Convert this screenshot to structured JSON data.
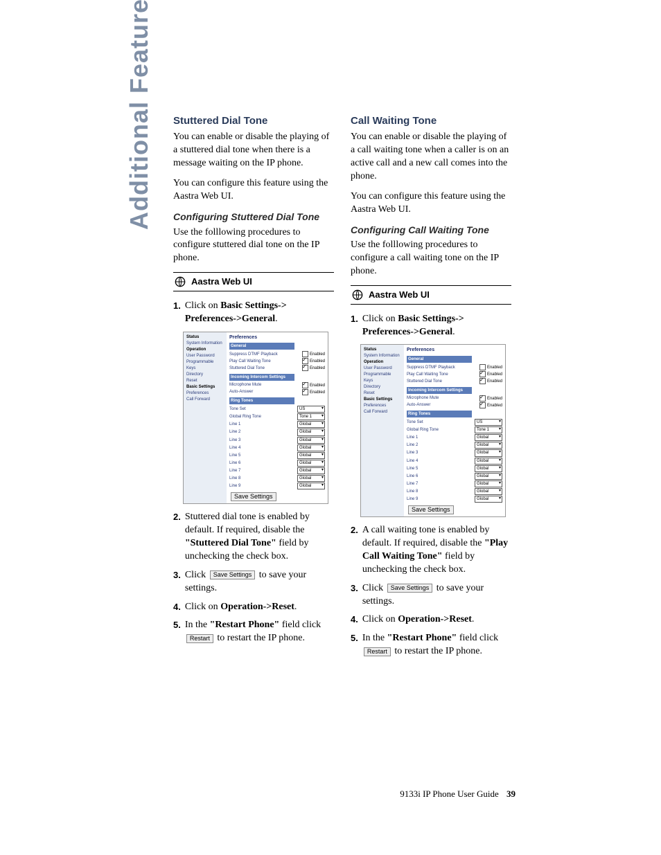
{
  "sideTitle": "Additional Features",
  "footer": {
    "guide": "9133i IP Phone User Guide",
    "page": "39"
  },
  "common": {
    "webUiLabel": "Aastra Web UI",
    "saveSettingsBtn": "Save Settings",
    "restartBtn": "Restart"
  },
  "left": {
    "h1": "Stuttered Dial Tone",
    "p1": "You can enable or disable the playing of a stuttered dial tone when there is a message waiting on the IP phone.",
    "p2": "You can configure this feature using the Aastra Web UI.",
    "h2": "Configuring Stuttered Dial Tone",
    "p3": "Use the folllowing procedures to configure stuttered dial tone on the IP phone.",
    "steps": {
      "s1a": "Click on ",
      "s1b": "Basic Settings-> Preferences->General",
      "s1c": ".",
      "s2a": "Stuttered dial tone is enabled by default. If required, disable the ",
      "s2b": "\"Stuttered Dial Tone\"",
      "s2c": " field by unchecking the check box.",
      "s3a": "Click ",
      "s3b": " to save your settings.",
      "s4a": "Click on ",
      "s4b": "Operation->Reset",
      "s4c": ".",
      "s5a": "In the ",
      "s5b": "\"Restart Phone\"",
      "s5c": " field click ",
      "s5d": " to restart the IP phone."
    }
  },
  "right": {
    "h1": "Call Waiting Tone",
    "p1": "You can enable or disable the playing of a call waiting tone when a caller is on an active call and a new call comes into the phone.",
    "p2": "You can configure this feature using the Aastra Web UI.",
    "h2": "Configuring Call Waiting Tone",
    "p3": "Use the folllowing procedures to configure a call waiting tone on the IP phone.",
    "steps": {
      "s1a": "Click on ",
      "s1b": "Basic Settings-> Preferences->General",
      "s1c": ".",
      "s2a": "A call waiting tone is enabled by default. If required, disable the ",
      "s2b": "\"Play Call Waiting Tone\"",
      "s2c": " field by unchecking the check box.",
      "s3a": "Click ",
      "s3b": " to save your settings.",
      "s4a": "Click on ",
      "s4b": "Operation->Reset",
      "s4c": ".",
      "s5a": "In the ",
      "s5b": "\"Restart Phone\"",
      "s5c": " field click ",
      "s5d": " to restart the IP phone."
    }
  },
  "shot": {
    "nav": {
      "status": "Status",
      "sysinfo": "System Information",
      "operation": "Operation",
      "userpw": "User Password",
      "progkeys": "Programmable Keys",
      "directory": "Directory",
      "reset": "Reset",
      "basic": "Basic Settings",
      "prefs": "Preferences",
      "callfwd": "Call Forward"
    },
    "main": {
      "title": "Preferences",
      "secGeneral": "General",
      "rowSuppress": "Suppress DTMF Playback",
      "rowPlayCW": "Play Call Waiting Tone",
      "rowStutter": "Stuttered Dial Tone",
      "secIncoming": "Incoming Intercom Settings",
      "rowMicMute": "Microphone Mute",
      "rowAutoAns": "Auto-Answer",
      "secRing": "Ring Tones",
      "rowToneSet": "Tone Set",
      "rowGlobal": "Global Ring Tone",
      "lines": [
        "Line 1",
        "Line 2",
        "Line 3",
        "Line 4",
        "Line 5",
        "Line 6",
        "Line 7",
        "Line 8",
        "Line 9"
      ],
      "enabled": "Enabled",
      "us": "US",
      "tone1": "Tone 1",
      "global": "Global",
      "saveBtn": "Save Settings"
    }
  }
}
